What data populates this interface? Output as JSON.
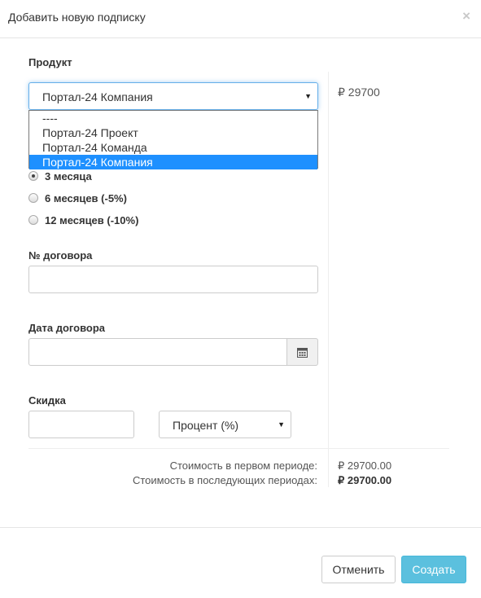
{
  "modal": {
    "title": "Добавить новую подписку",
    "close_glyph": "×"
  },
  "product": {
    "label": "Продукт",
    "selected": "Портал-24 Компания",
    "options": [
      "----",
      "Портал-24 Проект",
      "Портал-24 Команда",
      "Портал-24 Компания"
    ],
    "price": "₽ 29700"
  },
  "period": {
    "options": [
      {
        "label": "3 месяца",
        "checked": true
      },
      {
        "label": "6 месяцев (-5%)",
        "checked": false
      },
      {
        "label": "12 месяцев (-10%)",
        "checked": false
      }
    ]
  },
  "contract_number": {
    "label": "№ договора",
    "value": ""
  },
  "contract_date": {
    "label": "Дата договора",
    "value": "",
    "icon": "calendar-icon"
  },
  "discount": {
    "label": "Скидка",
    "value": "",
    "type_selected": "Процент (%)"
  },
  "costs": {
    "first_label": "Стоимость в первом периоде:",
    "first_value": "₽ 29700.00",
    "next_label": "Стоимость в последующих периодах:",
    "next_value": "₽ 29700.00"
  },
  "footer": {
    "cancel_label": "Отменить",
    "create_label": "Создать"
  },
  "colors": {
    "accent": "#5bc0de",
    "focus": "#66afe9",
    "selection": "#1e90ff"
  }
}
